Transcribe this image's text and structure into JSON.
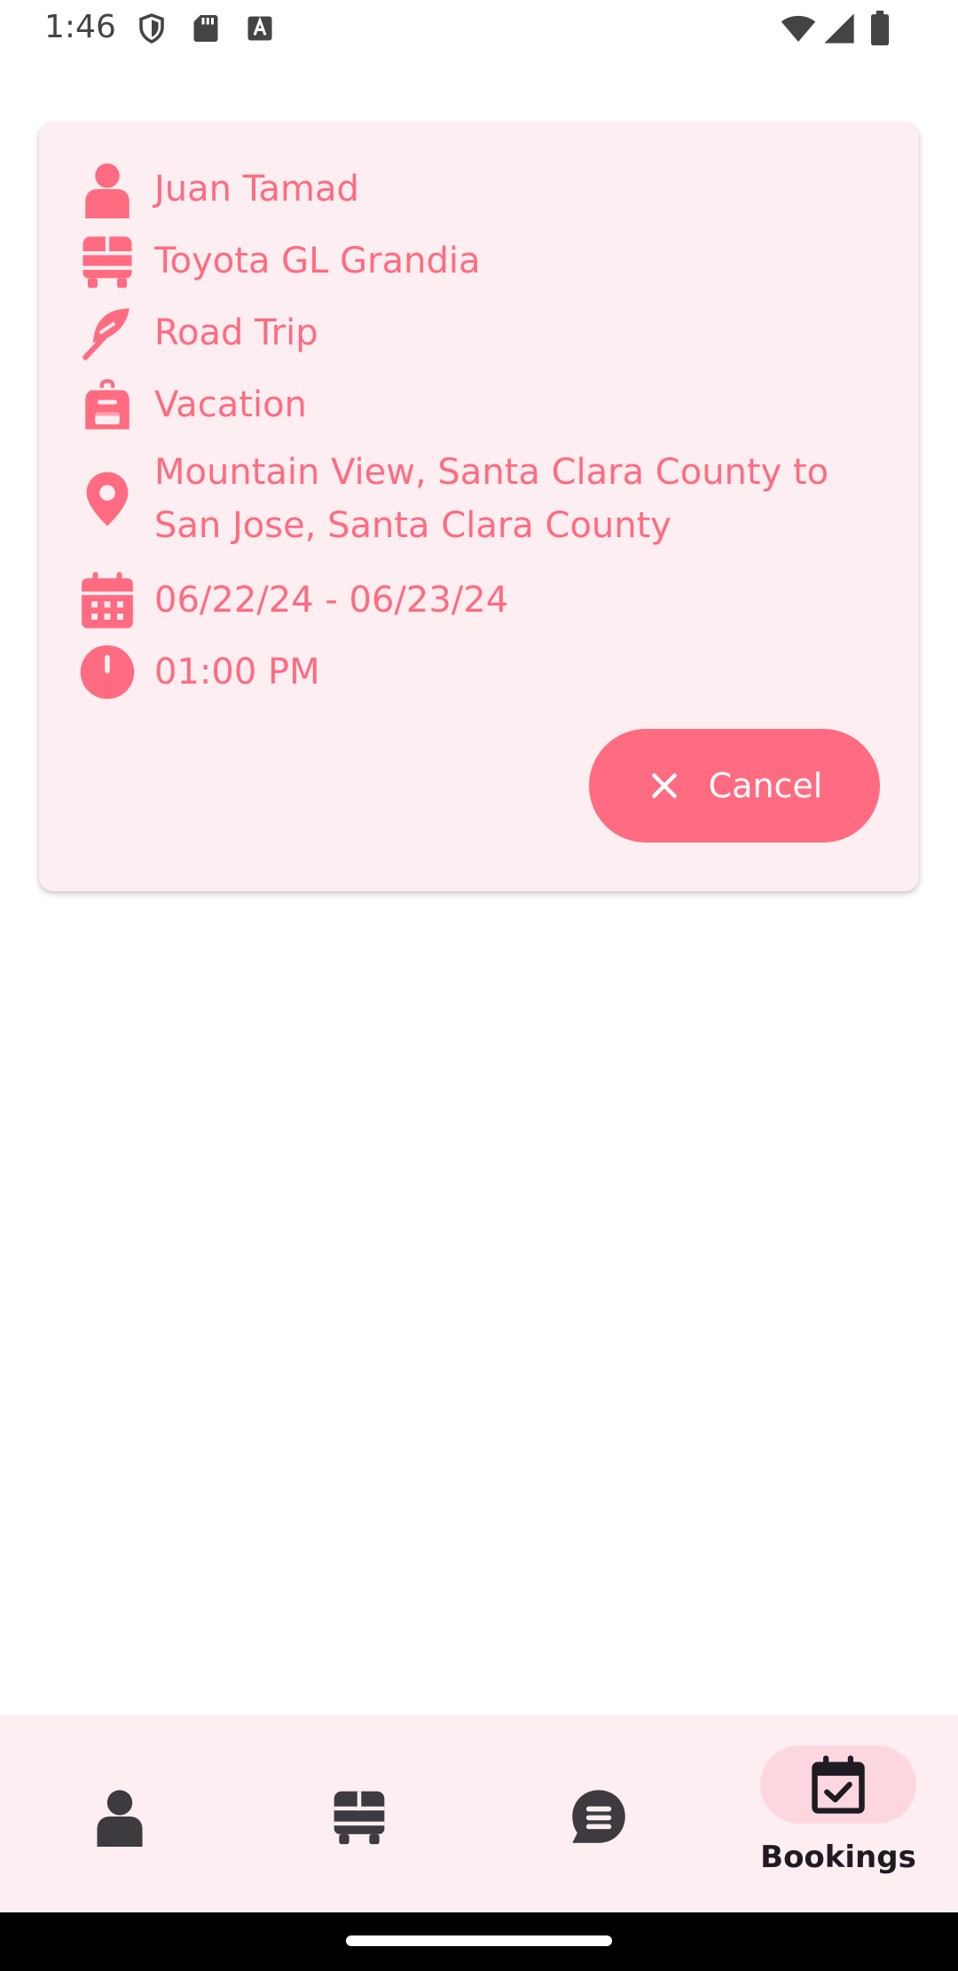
{
  "status_bar": {
    "time": "1:46",
    "icons": [
      "shield-icon",
      "sd-card-icon",
      "keyboard-a-icon",
      "wifi-icon",
      "signal-icon",
      "battery-icon"
    ]
  },
  "booking": {
    "name": "Juan Tamad",
    "vehicle": "Toyota GL Grandia",
    "trip_type": "Road Trip",
    "purpose": "Vacation",
    "route_line1": "Mountain View, Santa Clara County to",
    "route_line2": "San Jose, Santa Clara County",
    "dates": "06/22/24 - 06/23/24",
    "time": "01:00 PM",
    "cancel_label": "Cancel"
  },
  "bottom_nav": {
    "items": [
      {
        "icon": "person-icon",
        "label": ""
      },
      {
        "icon": "bus-icon",
        "label": ""
      },
      {
        "icon": "chat-icon",
        "label": ""
      },
      {
        "icon": "calendar-check-icon",
        "label": "Bookings",
        "active": true
      }
    ]
  },
  "colors": {
    "accent": "#ff6b80",
    "card_background": "#fdeef1",
    "active_pill": "#fdd7df",
    "nav_icon": "#3d3a40"
  }
}
